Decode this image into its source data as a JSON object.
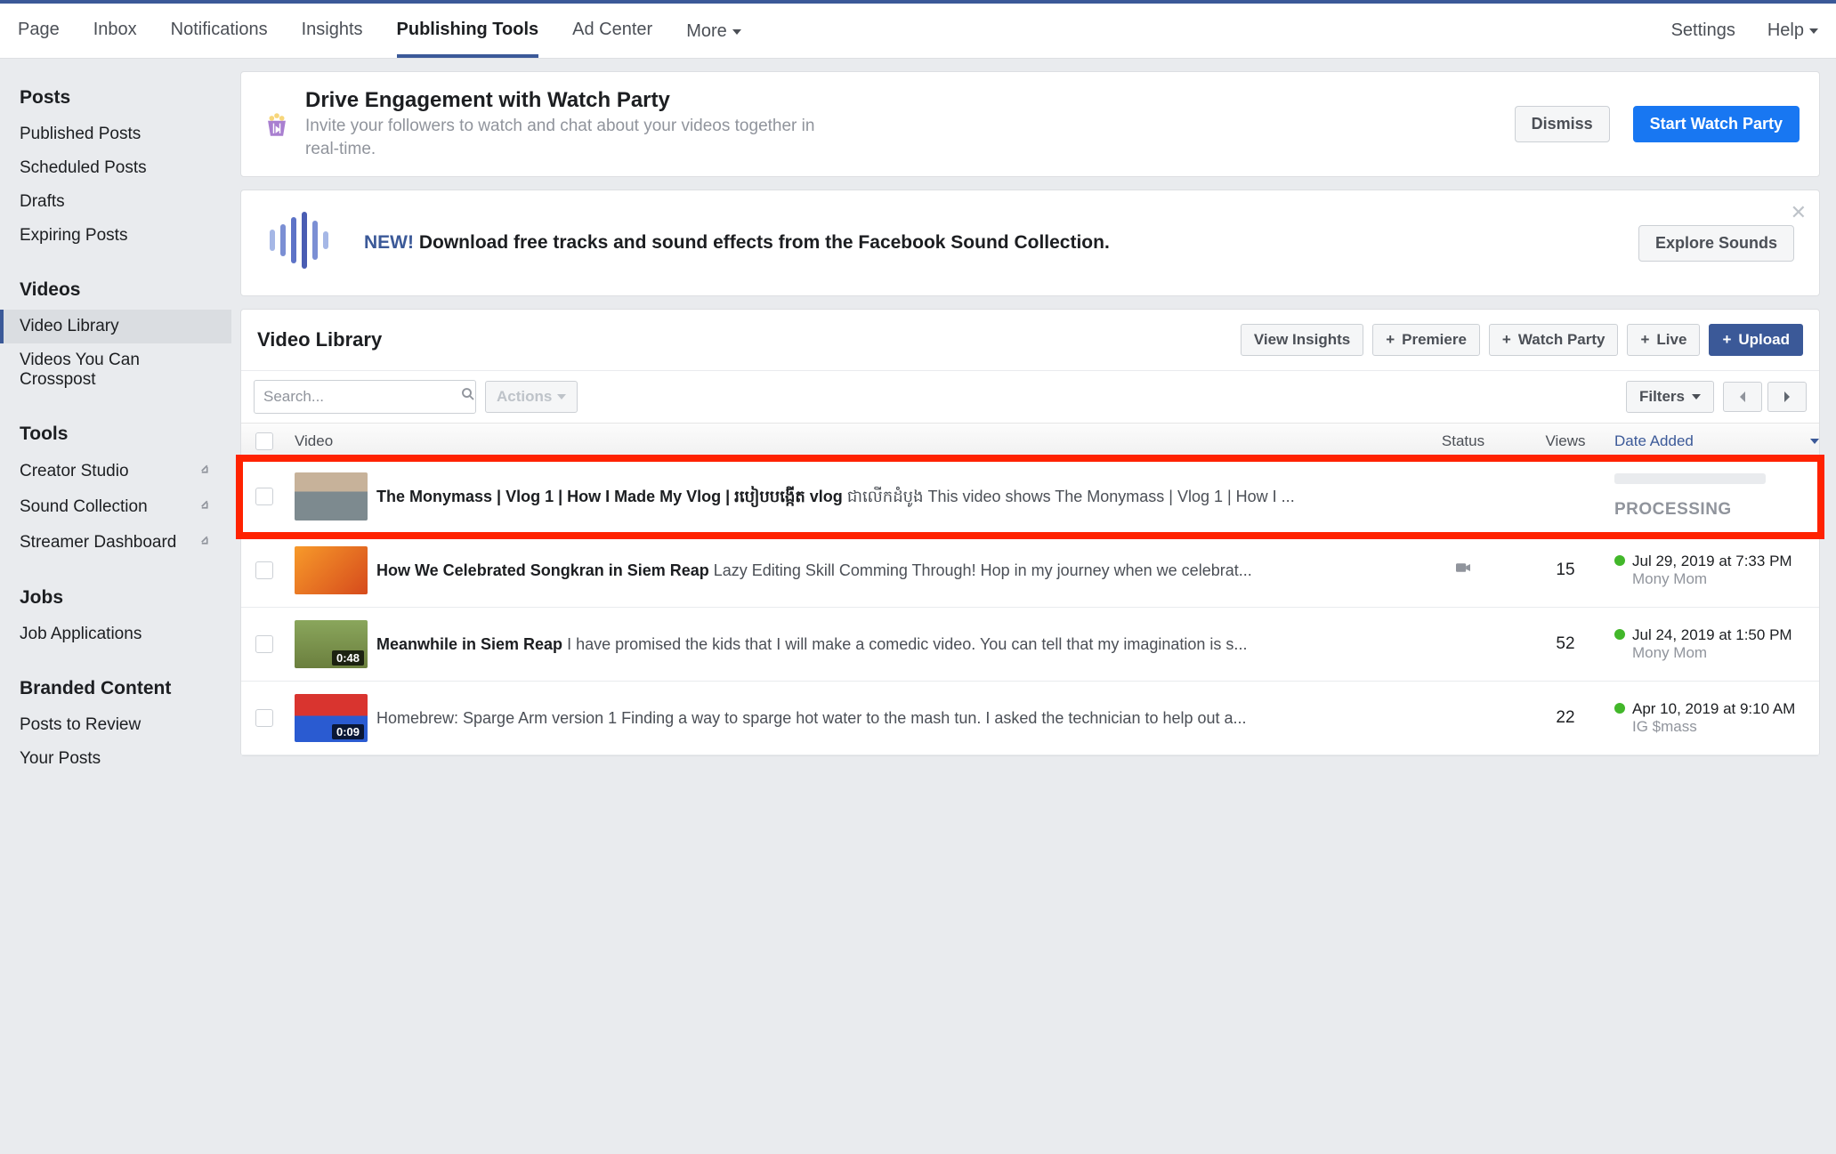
{
  "topnav": {
    "items": [
      "Page",
      "Inbox",
      "Notifications",
      "Insights",
      "Publishing Tools",
      "Ad Center"
    ],
    "active": 4,
    "more": "More",
    "settings": "Settings",
    "help": "Help"
  },
  "sidebar": {
    "posts": {
      "heading": "Posts",
      "items": [
        "Published Posts",
        "Scheduled Posts",
        "Drafts",
        "Expiring Posts"
      ]
    },
    "videos": {
      "heading": "Videos",
      "items": [
        "Video Library",
        "Videos You Can Crosspost"
      ],
      "active": 0
    },
    "tools": {
      "heading": "Tools",
      "items": [
        "Creator Studio",
        "Sound Collection",
        "Streamer Dashboard"
      ]
    },
    "jobs": {
      "heading": "Jobs",
      "items": [
        "Job Applications"
      ]
    },
    "branded": {
      "heading": "Branded Content",
      "items": [
        "Posts to Review",
        "Your Posts"
      ]
    }
  },
  "promo_watch": {
    "title": "Drive Engagement with Watch Party",
    "subtitle": "Invite your followers to watch and chat about your videos together in real-time.",
    "dismiss": "Dismiss",
    "cta": "Start Watch Party"
  },
  "promo_sound": {
    "new": "NEW!",
    "text": "Download free tracks and sound effects from the Facebook Sound Collection.",
    "cta": "Explore Sounds"
  },
  "library": {
    "title": "Video Library",
    "buttons": {
      "view_insights": "View Insights",
      "premiere": "Premiere",
      "watch_party": "Watch Party",
      "live": "Live",
      "upload": "Upload"
    },
    "search_placeholder": "Search...",
    "actions": "Actions",
    "filters": "Filters",
    "columns": {
      "video": "Video",
      "status": "Status",
      "views": "Views",
      "date": "Date Added"
    },
    "rows": [
      {
        "title": "The Monymass | Vlog 1 | How I Made My Vlog | របៀបបង្កើត vlog",
        "desc": " ជាលើកដំបូង This video shows The Monymass | Vlog 1 | How I ...",
        "status": "",
        "views": "",
        "date": "",
        "by": "",
        "processing": true,
        "processing_text": "PROCESSING",
        "duration": "",
        "thumb_bg": "linear-gradient(180deg,#c7b29a 40%,#7d8a8f 40%)",
        "thumb_accent": "#f2d94e",
        "highlight": true
      },
      {
        "title": "How We Celebrated Songkran in Siem Reap",
        "desc": " Lazy Editing Skill Comming Through! Hop in my journey when we celebrat...",
        "status": "cam",
        "views": "15",
        "date": "Jul 29, 2019 at 7:33 PM",
        "by": "Mony Mom",
        "duration": "",
        "thumb_bg": "linear-gradient(135deg,#f79a2a,#d64a1c)"
      },
      {
        "title": "Meanwhile in Siem Reap",
        "desc": " I have promised the kids that I will make a comedic video. You can tell that my imagination is s...",
        "status": "dot",
        "views": "52",
        "date": "Jul 24, 2019 at 1:50 PM",
        "by": "Mony Mom",
        "duration": "0:48",
        "thumb_bg": "linear-gradient(180deg,#8aa65c,#6b7f3e)"
      },
      {
        "title": "",
        "desc": "Homebrew: Sparge Arm version 1 Finding a way to sparge hot water to the mash tun. I asked the technician to help out a...",
        "status": "dot",
        "views": "22",
        "date": "Apr 10, 2019 at 9:10 AM",
        "by": "IG $mass",
        "duration": "0:09",
        "thumb_bg": "linear-gradient(180deg,#d9342f 45%,#2a5bd1 45%)"
      }
    ]
  }
}
